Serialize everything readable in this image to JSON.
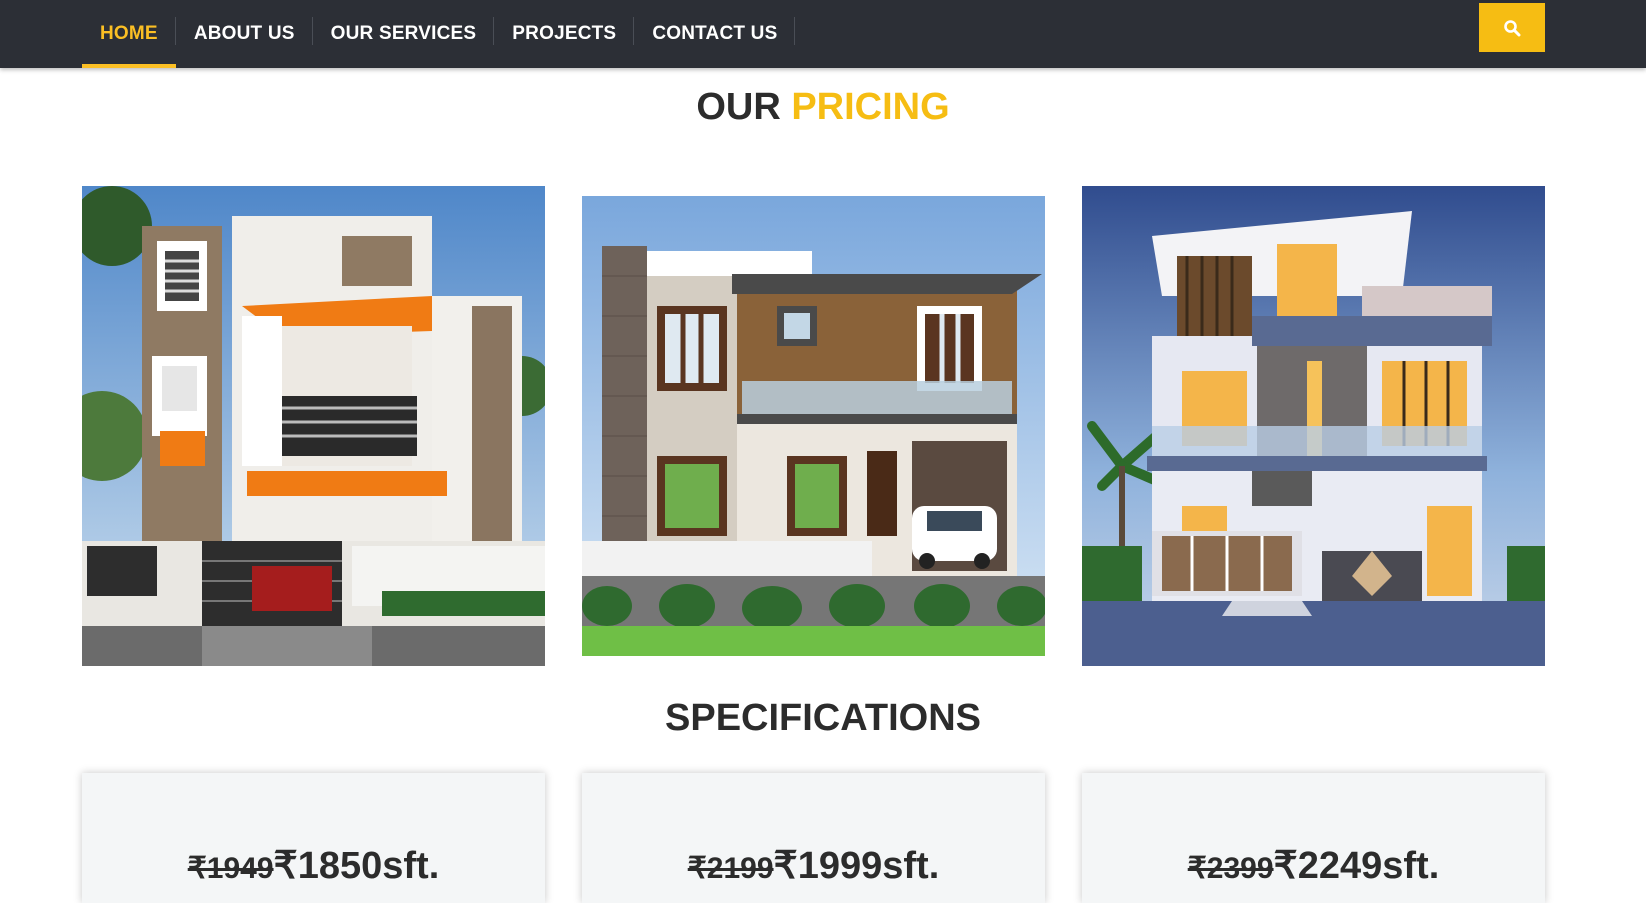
{
  "nav": {
    "items": [
      {
        "label": "HOME",
        "active": true
      },
      {
        "label": "ABOUT US",
        "active": false
      },
      {
        "label": "OUR SERVICES",
        "active": false
      },
      {
        "label": "PROJECTS",
        "active": false
      },
      {
        "label": "CONTACT US",
        "active": false
      }
    ],
    "search_icon": "search-icon"
  },
  "pricing": {
    "title_part1": "OUR",
    "title_part2": "PRICING"
  },
  "specifications": {
    "title": "SPECIFICATIONS"
  },
  "plans": [
    {
      "old_price": "₹1949",
      "new_price": "₹1850sft."
    },
    {
      "old_price": "₹2199",
      "new_price": "₹1999sft."
    },
    {
      "old_price": "₹2399",
      "new_price": "₹2249sft."
    }
  ],
  "colors": {
    "accent": "#f6bd13",
    "nav_bg": "#2c2f36",
    "card_bg": "#f4f6f7"
  }
}
